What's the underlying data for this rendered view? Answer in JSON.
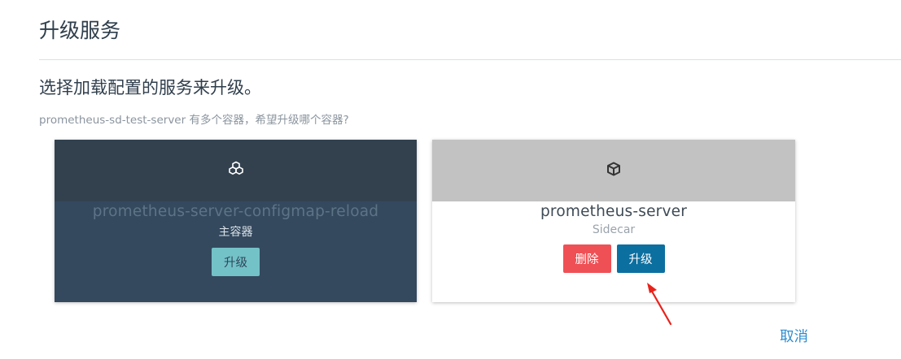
{
  "page": {
    "title": "升级服务"
  },
  "section": {
    "title": "选择加载配置的服务来升级。",
    "description": "prometheus-sd-test-server 有多个容器，希望升级哪个容器?"
  },
  "containers": [
    {
      "name": "prometheus-server-configmap-reload",
      "role": "主容器",
      "icon": "cubes-icon",
      "upgrade_label": "升级"
    },
    {
      "name": "prometheus-server",
      "role": "Sidecar",
      "icon": "cube-icon",
      "delete_label": "删除",
      "upgrade_label": "升级"
    }
  ],
  "footer": {
    "cancel_label": "取消"
  },
  "colors": {
    "primary_card": "#34495e",
    "accent_teal": "#73c2c8",
    "danger": "#ef5055",
    "primary_button": "#0b6fa0",
    "link": "#2e8ccf",
    "annotation_arrow": "#e8221b"
  }
}
